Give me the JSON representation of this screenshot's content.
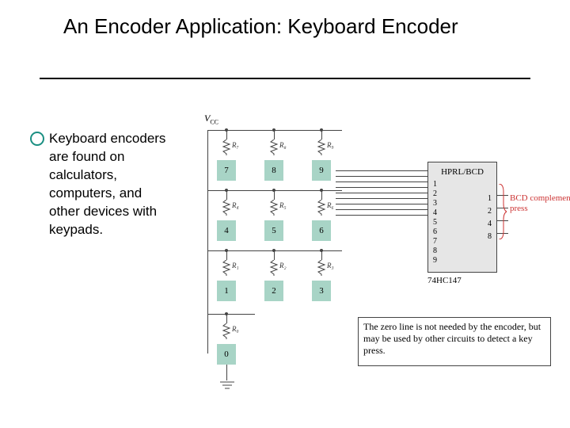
{
  "title": "An Encoder Application: Keyboard Encoder",
  "body": "Keyboard encoders are found on calculators, computers, and other devices with keypads.",
  "vcc": "V",
  "vcc_sub": "CC",
  "resistors": {
    "r7": "R₇",
    "r8": "R₈",
    "r9": "R₉",
    "r4": "R₄",
    "r5": "R₅",
    "r6": "R₆",
    "r1": "R₁",
    "r2": "R₂",
    "r3": "R₃",
    "r0": "R₀"
  },
  "keys": {
    "k7": "7",
    "k8": "8",
    "k9": "9",
    "k4": "4",
    "k5": "5",
    "k6": "6",
    "k1": "1",
    "k2": "2",
    "k3": "3",
    "k0": "0"
  },
  "chip": {
    "title": "HPRL/BCD",
    "part": "74HC147",
    "inputs": [
      "1",
      "2",
      "3",
      "4",
      "5",
      "6",
      "7",
      "8",
      "9"
    ],
    "outputs": [
      "1",
      "2",
      "4",
      "8"
    ]
  },
  "bcd_label": "BCD complement of key press",
  "note": "The zero line is not needed by the encoder, but may be used by other circuits to detect a key press."
}
